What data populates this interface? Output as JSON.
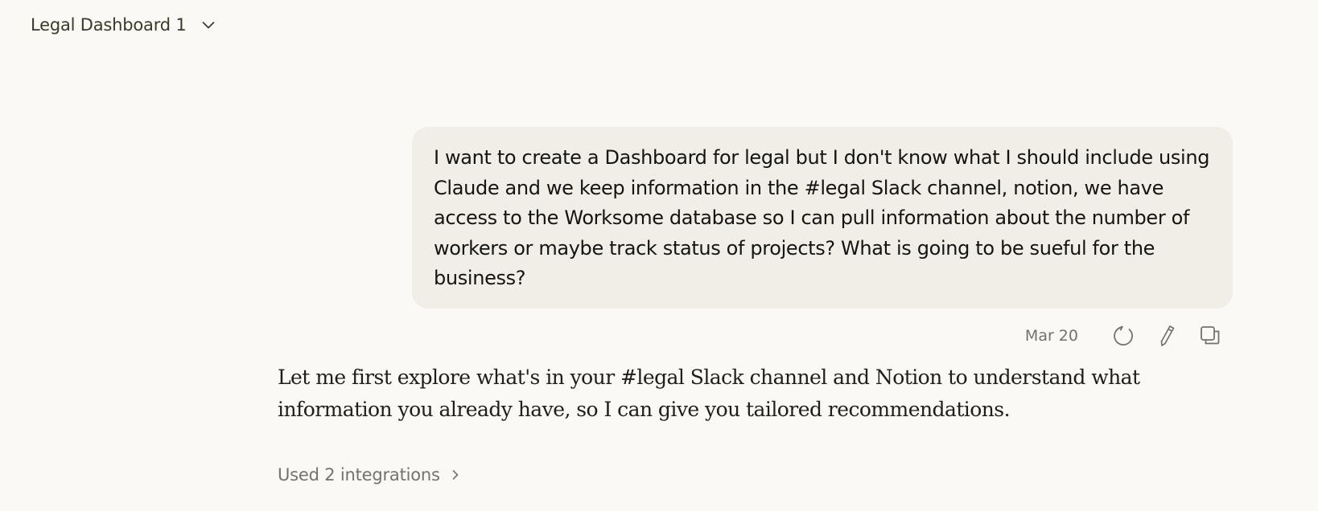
{
  "header": {
    "title": "Legal Dashboard 1",
    "dropdown_icon": "chevron-down-icon"
  },
  "user_message": {
    "text": "I want to create a Dashboard for legal but I don't know what I should include using Claude and we keep information in the #legal Slack channel, notion, we have access to the Worksome database so I can pull information about the number of workers or maybe track status of projects? What is going to be sueful for the business?",
    "timestamp": "Mar 20",
    "actions": [
      "retry-icon",
      "edit-icon",
      "copy-icon"
    ]
  },
  "assistant_message": {
    "text": "Let me first explore what's in your #legal Slack channel and Notion to understand what information you already have, so I can give you tailored recommendations."
  },
  "integrations": {
    "label": "Used 2 integrations",
    "icon": "chevron-right-icon"
  },
  "colors": {
    "background": "#faf9f5",
    "user_bubble": "#f0eee6",
    "text_primary": "#141413",
    "text_muted": "#73726c"
  }
}
